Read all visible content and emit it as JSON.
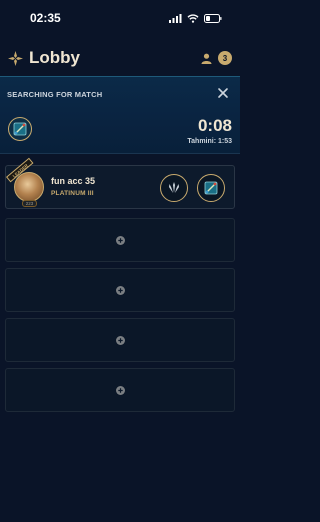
{
  "status_bar": {
    "time": "02:35"
  },
  "header": {
    "title": "Lobby",
    "notification_count": "3"
  },
  "queue": {
    "label": "SEARCHING FOR MATCH",
    "timer": "0:08",
    "estimate": "Tahmini: 1:53"
  },
  "party": {
    "player": {
      "name": "fun acc 35",
      "rank": "PLATINUM III",
      "banner": "LEADER",
      "level": "223"
    },
    "empty_slots": 4
  },
  "colors": {
    "accent_gold": "#c8aa6e",
    "background": "#0a1428",
    "queue_panel": "#0b2a48"
  }
}
